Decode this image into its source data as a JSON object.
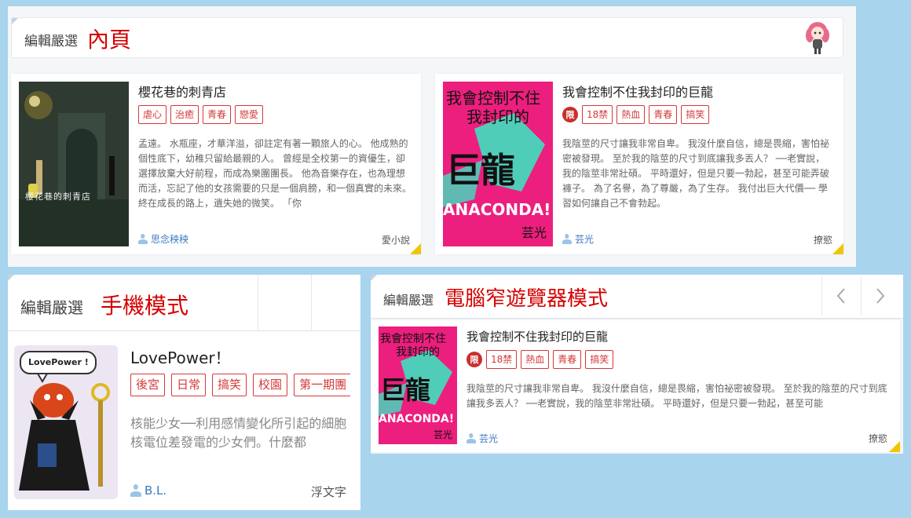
{
  "header_label": "編輯嚴選",
  "panel_inner": {
    "title_red": "內頁",
    "cards": [
      {
        "title": "櫻花巷的刺青店",
        "restricted": false,
        "tags": [
          "虐心",
          "治癒",
          "青春",
          "戀愛"
        ],
        "description": "孟遠。 水瓶座，才華洋溢，卻註定有著一顆旅人的心。 他成熟的個性底下，幼稚只留給最親的人。 曾經是全校第一的資優生，卻選擇放棄大好前程，而成為樂團團長。 他為音樂存在，也為理想而活，忘記了他的女孩需要的只是一個肩膀，和一個真實的未來。 終在成長的路上，遺失她的微笑。 「你",
        "author": "思念秧秧",
        "site": "愛小說",
        "cover_title": "櫻花巷的刺青店"
      },
      {
        "title": "我會控制不住我封印的巨龍",
        "restricted": true,
        "restrict_label": "限",
        "tags": [
          "18禁",
          "熱血",
          "青春",
          "搞笑"
        ],
        "description": "我陰莖的尺寸讓我非常自卑。 我沒什麼自信，總是畏縮，害怕祕密被發現。 至於我的陰莖的尺寸到底讓我多丟人？ ──老實說，我的陰莖非常壯碩。 平時還好，但是只要一勃起，甚至可能弄破褲子。 為了名譽，為了尊嚴，為了生存。 我付出巨大代價── 學習如何讓自己不會勃起。",
        "author": "芸光",
        "site": "撩慾",
        "cover_title": "我會控制不住我封印的巨龍"
      }
    ]
  },
  "panel_mobile": {
    "title_red": "手機模式",
    "card": {
      "title": "LovePower！",
      "tags": [
        "後宮",
        "日常",
        "搞笑",
        "校園",
        "第一期團"
      ],
      "description": "核能少女──利用感情變化所引起的細胞核電位差發電的少女們。什麼都",
      "author": "B.L.",
      "site": "浮文字",
      "cover_bubble": "LovePower !"
    }
  },
  "panel_narrow": {
    "title_red": "電腦窄遊覽器模式",
    "prev_icon": "chevron-left-icon",
    "next_icon": "chevron-right-icon",
    "card": {
      "title": "我會控制不住我封印的巨龍",
      "restrict_label": "限",
      "tags": [
        "18禁",
        "熱血",
        "青春",
        "搞笑"
      ],
      "description": "我陰莖的尺寸讓我非常自卑。 我沒什麼自信，總是畏縮，害怕祕密被發現。 至於我的陰莖的尺寸到底讓我多丟人？ ──老實說，我的陰莖非常壯碩。 平時還好，但是只要一勃起，甚至可能",
      "author": "芸光",
      "site": "撩慾",
      "cover_title": "我會控制不住我封印的巨龍"
    }
  },
  "colors": {
    "accent_red": "#d60000",
    "tag_red": "#d43a3a",
    "author_blue": "#3b7bbf",
    "fold_yellow": "#f2c400",
    "background": "#a9d4ee"
  }
}
